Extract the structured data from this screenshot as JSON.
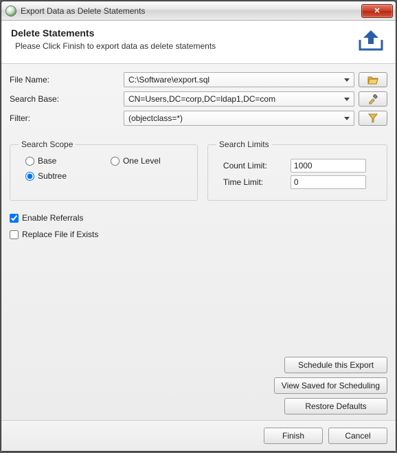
{
  "window": {
    "title": "Export Data as Delete Statements"
  },
  "header": {
    "title": "Delete Statements",
    "subtitle": "Please Click Finish to export data as delete statements"
  },
  "form": {
    "file_name_label": "File Name:",
    "file_name_value": "C:\\Software\\export.sql",
    "search_base_label": "Search Base:",
    "search_base_value": "CN=Users,DC=corp,DC=ldap1,DC=com",
    "filter_label": "Filter:",
    "filter_value": "(objectclass=*)"
  },
  "scope": {
    "legend": "Search Scope",
    "base_label": "Base",
    "one_level_label": "One Level",
    "subtree_label": "Subtree",
    "selected": "subtree"
  },
  "limits": {
    "legend": "Search Limits",
    "count_label": "Count Limit:",
    "count_value": "1000",
    "time_label": "Time Limit:",
    "time_value": "0"
  },
  "options": {
    "enable_referrals_label": "Enable Referrals",
    "enable_referrals_checked": true,
    "replace_file_label": "Replace File if Exists",
    "replace_file_checked": false
  },
  "actions": {
    "schedule_label": "Schedule this Export",
    "view_saved_label": "View Saved for Scheduling",
    "restore_label": "Restore Defaults"
  },
  "footer": {
    "finish_label": "Finish",
    "cancel_label": "Cancel"
  }
}
